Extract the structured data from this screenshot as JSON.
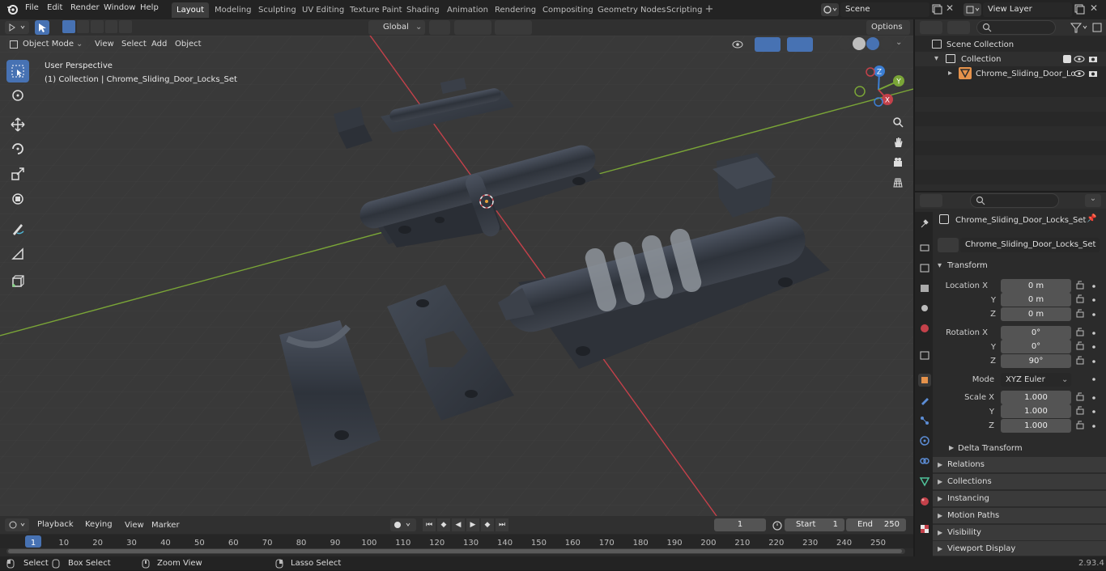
{
  "topbar": {
    "menus": [
      "File",
      "Edit",
      "Render",
      "Window",
      "Help"
    ],
    "workspaces": [
      "Layout",
      "Modeling",
      "Sculpting",
      "UV Editing",
      "Texture Paint",
      "Shading",
      "Animation",
      "Rendering",
      "Compositing",
      "Geometry Nodes",
      "Scripting"
    ],
    "active_workspace": "Layout",
    "scene": "Scene",
    "view_layer": "View Layer"
  },
  "viewport": {
    "mode": "Object Mode",
    "menus": [
      "View",
      "Select",
      "Add",
      "Object"
    ],
    "orientation": "Global",
    "options_label": "Options",
    "perspective_label": "User Perspective",
    "collection_label": "(1) Collection | Chrome_Sliding_Door_Locks_Set",
    "gizmo_axes": {
      "x": "X",
      "y": "Y",
      "z": "Z"
    }
  },
  "outliner": {
    "root": "Scene Collection",
    "collection": "Collection",
    "object": "Chrome_Sliding_Door_Lo"
  },
  "properties": {
    "object_name": "Chrome_Sliding_Door_Locks_Set",
    "data_name": "Chrome_Sliding_Door_Locks_Set",
    "transform_title": "Transform",
    "location_label": "Location X",
    "rotation_label": "Rotation X",
    "scale_label": "Scale X",
    "y_label": "Y",
    "z_label": "Z",
    "location": [
      "0 m",
      "0 m",
      "0 m"
    ],
    "rotation": [
      "0°",
      "0°",
      "90°"
    ],
    "mode_label": "Mode",
    "mode_value": "XYZ Euler",
    "scale": [
      "1.000",
      "1.000",
      "1.000"
    ],
    "delta_transform": "Delta Transform",
    "panels": [
      "Relations",
      "Collections",
      "Instancing",
      "Motion Paths",
      "Visibility",
      "Viewport Display"
    ]
  },
  "timeline": {
    "menus": [
      "Playback",
      "Keying",
      "View",
      "Marker"
    ],
    "current_frame": "1",
    "start_label": "Start",
    "start_value": "1",
    "end_label": "End",
    "end_value": "250",
    "ticks": [
      "1",
      "10",
      "20",
      "30",
      "40",
      "50",
      "60",
      "70",
      "80",
      "90",
      "100",
      "110",
      "120",
      "130",
      "140",
      "150",
      "160",
      "170",
      "180",
      "190",
      "200",
      "210",
      "220",
      "230",
      "240",
      "250"
    ]
  },
  "statusbar": {
    "select": "Select",
    "box_select": "Box Select",
    "zoom_view": "Zoom View",
    "lasso_select": "Lasso Select",
    "version": "2.93.4"
  },
  "colors": {
    "accent": "#4772b3",
    "x_axis": "#c4414a",
    "y_axis": "#7aa537",
    "z_axis": "#3c7fd4",
    "frame_marker": "#4772b3"
  }
}
